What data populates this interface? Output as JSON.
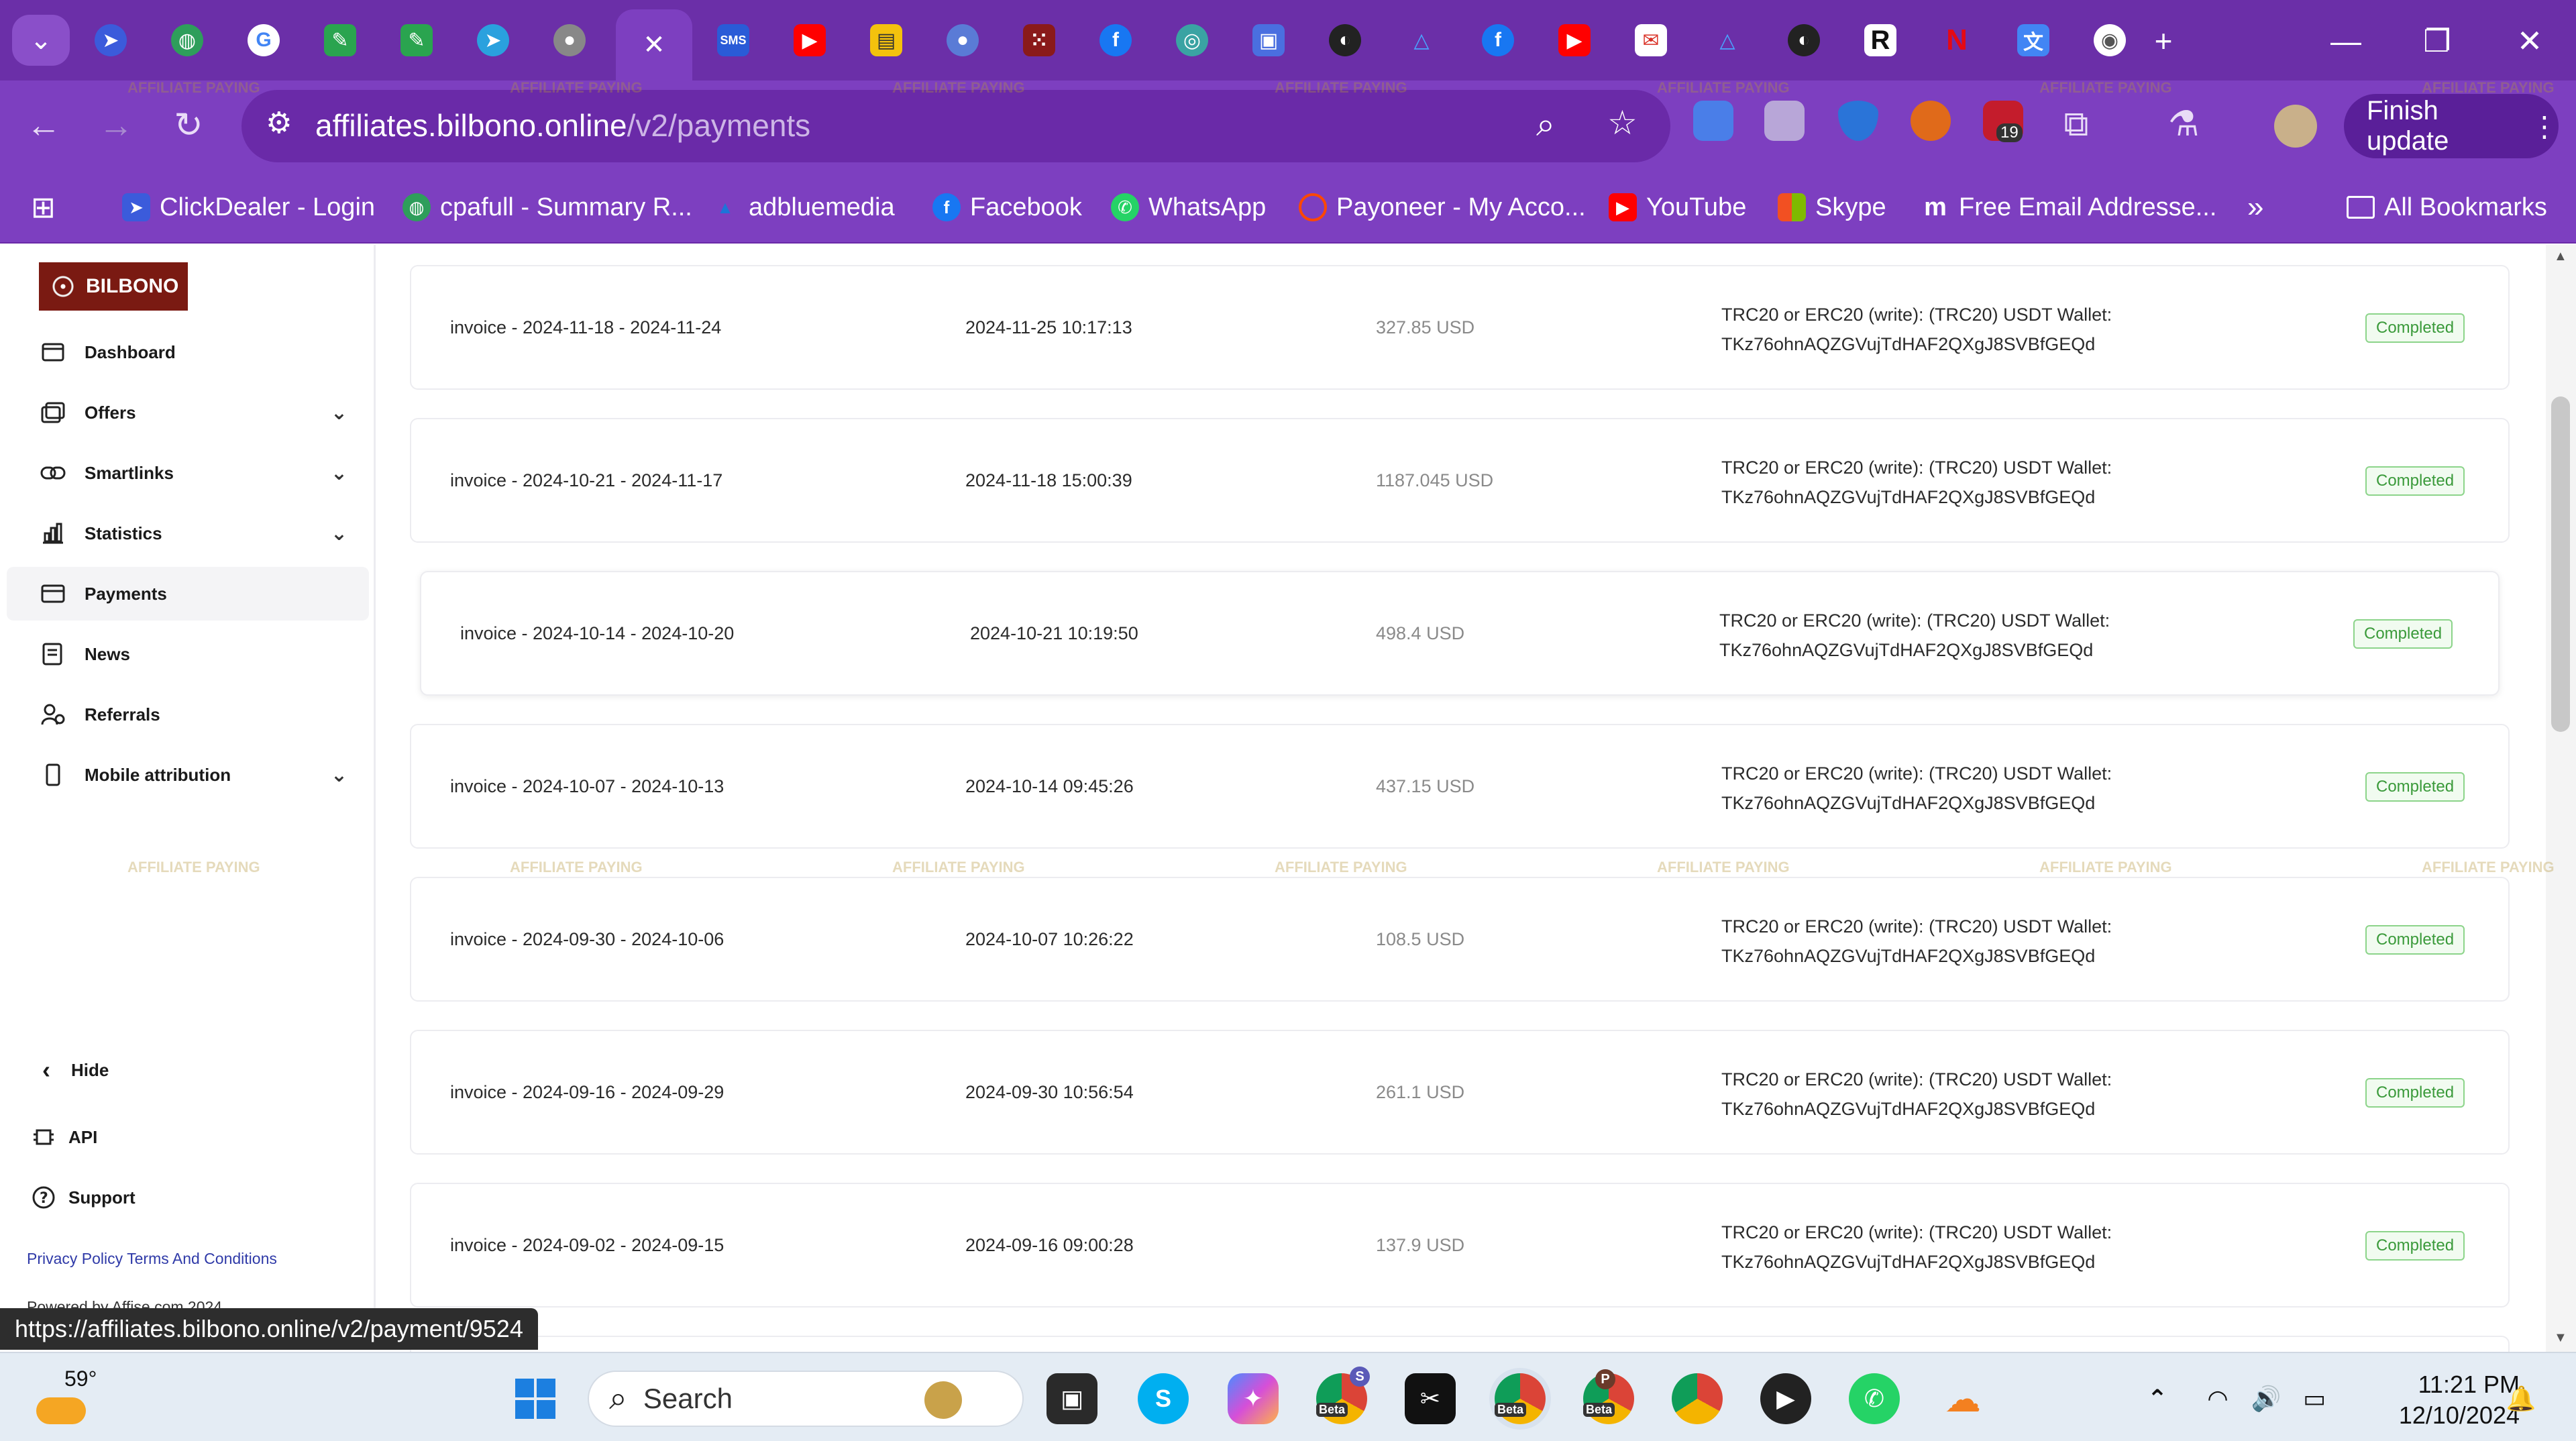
{
  "browser": {
    "active_tab_close": "✕",
    "new_tab": "+",
    "url_host": "affiliates.bilbono.online",
    "url_path": "/v2/payments",
    "finish_update": "Finish update",
    "ext_badge": "19",
    "tab_labels": {
      "sms": "SMS",
      "r": "R"
    }
  },
  "bookmarks": [
    {
      "label": "ClickDealer - Login",
      "color": "#3b5bdb"
    },
    {
      "label": "cpafull - Summary R...",
      "color": "#2e9e5b"
    },
    {
      "label": "adbluemedia",
      "color": "#1e74d8"
    },
    {
      "label": "Facebook",
      "color": "#1877f2"
    },
    {
      "label": "WhatsApp",
      "color": "#25d366"
    },
    {
      "label": "Payoneer - My Acco...",
      "color": "#ff4800"
    },
    {
      "label": "YouTube",
      "color": "#ff0000"
    },
    {
      "label": "Skype",
      "color": "#ffb900"
    },
    {
      "label": "Free Email Addresse...",
      "color": "#5b5bd6"
    }
  ],
  "bookmarks_overflow": "»",
  "bookmarks_all": "All Bookmarks",
  "sidebar": {
    "logo_text": "BILBONO",
    "items": [
      {
        "label": "Dashboard"
      },
      {
        "label": "Offers"
      },
      {
        "label": "Smartlinks"
      },
      {
        "label": "Statistics"
      },
      {
        "label": "Payments"
      },
      {
        "label": "News"
      },
      {
        "label": "Referrals"
      },
      {
        "label": "Mobile attribution"
      }
    ],
    "hide": "Hide",
    "api": "API",
    "support": "Support",
    "privacy": "Privacy Policy",
    "terms": "Terms And Conditions",
    "powered": "Powered by Affise.com 2024"
  },
  "payments": [
    {
      "invoice": "invoice - 2024-11-18 - 2024-11-24",
      "date": "2024-11-25 10:17:13",
      "amount": "327.85 USD",
      "wallet_line1": "TRC20 or ERC20 (write): (TRC20) USDT Wallet:",
      "wallet_line2": "TKz76ohnAQZGVujTdHAF2QXgJ8SVBfGEQd",
      "status": "Completed"
    },
    {
      "invoice": "invoice - 2024-10-21 - 2024-11-17",
      "date": "2024-11-18 15:00:39",
      "amount": "1187.045 USD",
      "wallet_line1": "TRC20 or ERC20 (write): (TRC20) USDT Wallet:",
      "wallet_line2": "TKz76ohnAQZGVujTdHAF2QXgJ8SVBfGEQd",
      "status": "Completed"
    },
    {
      "invoice": "invoice - 2024-10-14 - 2024-10-20",
      "date": "2024-10-21 10:19:50",
      "amount": "498.4 USD",
      "wallet_line1": "TRC20 or ERC20 (write): (TRC20) USDT Wallet:",
      "wallet_line2": "TKz76ohnAQZGVujTdHAF2QXgJ8SVBfGEQd",
      "status": "Completed"
    },
    {
      "invoice": "invoice - 2024-10-07 - 2024-10-13",
      "date": "2024-10-14 09:45:26",
      "amount": "437.15 USD",
      "wallet_line1": "TRC20 or ERC20 (write): (TRC20) USDT Wallet:",
      "wallet_line2": "TKz76ohnAQZGVujTdHAF2QXgJ8SVBfGEQd",
      "status": "Completed"
    },
    {
      "invoice": "invoice - 2024-09-30 - 2024-10-06",
      "date": "2024-10-07 10:26:22",
      "amount": "108.5 USD",
      "wallet_line1": "TRC20 or ERC20 (write): (TRC20) USDT Wallet:",
      "wallet_line2": "TKz76ohnAQZGVujTdHAF2QXgJ8SVBfGEQd",
      "status": "Completed"
    },
    {
      "invoice": "invoice - 2024-09-16 - 2024-09-29",
      "date": "2024-09-30 10:56:54",
      "amount": "261.1 USD",
      "wallet_line1": "TRC20 or ERC20 (write): (TRC20) USDT Wallet:",
      "wallet_line2": "TKz76ohnAQZGVujTdHAF2QXgJ8SVBfGEQd",
      "status": "Completed"
    },
    {
      "invoice": "invoice - 2024-09-02 - 2024-09-15",
      "date": "2024-09-16 09:00:28",
      "amount": "137.9 USD",
      "wallet_line1": "TRC20 or ERC20 (write): (TRC20) USDT Wallet:",
      "wallet_line2": "TKz76ohnAQZGVujTdHAF2QXgJ8SVBfGEQd",
      "status": "Completed"
    }
  ],
  "status_url": "https://affiliates.bilbono.online/v2/payment/9524",
  "taskbar": {
    "weather": "59°",
    "search": "Search",
    "beta": "Beta",
    "badge_s": "S",
    "badge_p": "P",
    "time": "11:21 PM",
    "date": "12/10/2024"
  },
  "watermark": "AFFILIATE PAYING",
  "colors": {
    "brand_purple": "#7d3fc0",
    "completed_green": "#3a9a3a"
  }
}
